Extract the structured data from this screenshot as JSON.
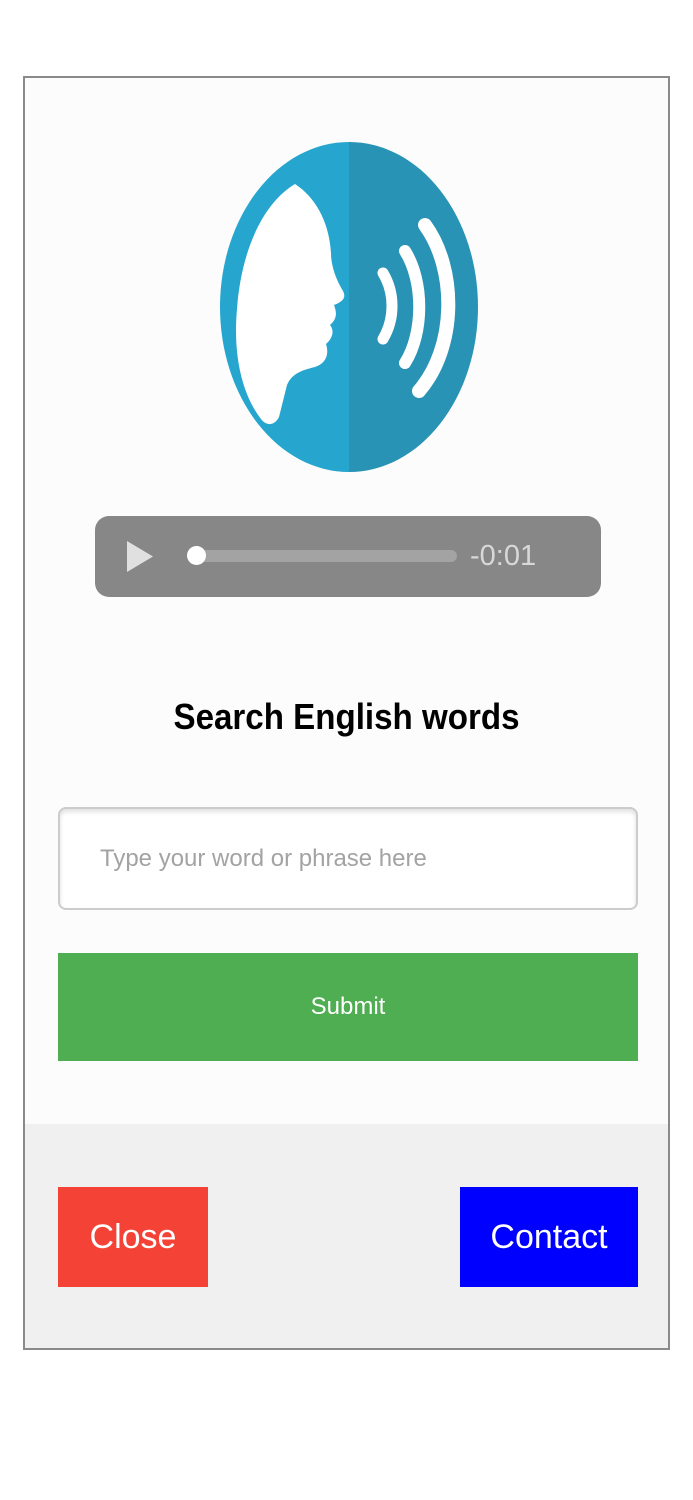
{
  "logo": {
    "icon": "speaking-head-icon",
    "colors": {
      "left": "#26a6cf",
      "right": "#2893b5",
      "foreground": "#ffffff"
    }
  },
  "audio": {
    "time": "-0:01",
    "progress": 0.0,
    "colors": {
      "background": "#878787",
      "track": "#a3a3a3",
      "thumb": "#ffffff"
    }
  },
  "search": {
    "title": "Search English words",
    "placeholder": "Type your word or phrase here",
    "value": "",
    "submit_label": "Submit"
  },
  "footer": {
    "close_label": "Close",
    "contact_label": "Contact"
  },
  "colors": {
    "submit": "#4eae51",
    "close": "#f44336",
    "contact": "#0000ff"
  }
}
